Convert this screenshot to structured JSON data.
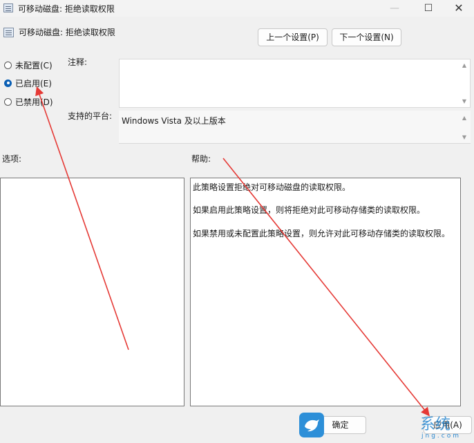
{
  "window": {
    "title": "可移动磁盘: 拒绝读取权限",
    "min_glyph": "—",
    "max_glyph": "☐",
    "close_glyph": "✕"
  },
  "header": {
    "policy_name": "可移动磁盘: 拒绝读取权限",
    "prev_button": "上一个设置(P)",
    "next_button": "下一个设置(N)"
  },
  "state": {
    "options": [
      {
        "label": "未配置(C)",
        "selected": false
      },
      {
        "label": "已启用(E)",
        "selected": true
      },
      {
        "label": "已禁用(D)",
        "selected": false
      }
    ]
  },
  "fields": {
    "comment_label": "注释:",
    "comment_value": "",
    "platform_label": "支持的平台:",
    "platform_value": "Windows Vista 及以上版本"
  },
  "panes": {
    "options_label": "选项:",
    "help_label": "帮助:",
    "help_paragraphs": [
      "此策略设置拒绝对可移动磁盘的读取权限。",
      "如果启用此策略设置，则将拒绝对此可移动存储类的读取权限。",
      "如果禁用或未配置此策略设置，则允许对此可移动存储类的读取权限。"
    ]
  },
  "footer": {
    "ok_button": "确定",
    "apply_button": "应用(A)"
  },
  "watermark": {
    "text": "系统",
    "domain": "jng.com"
  },
  "icons": {
    "title": "policy-icon",
    "header": "policy-icon",
    "watermark": "bird-icon"
  },
  "colors": {
    "annotation_arrow": "#e53935",
    "radio_selected": "#0a5fb4",
    "watermark": "#2a88d0"
  }
}
